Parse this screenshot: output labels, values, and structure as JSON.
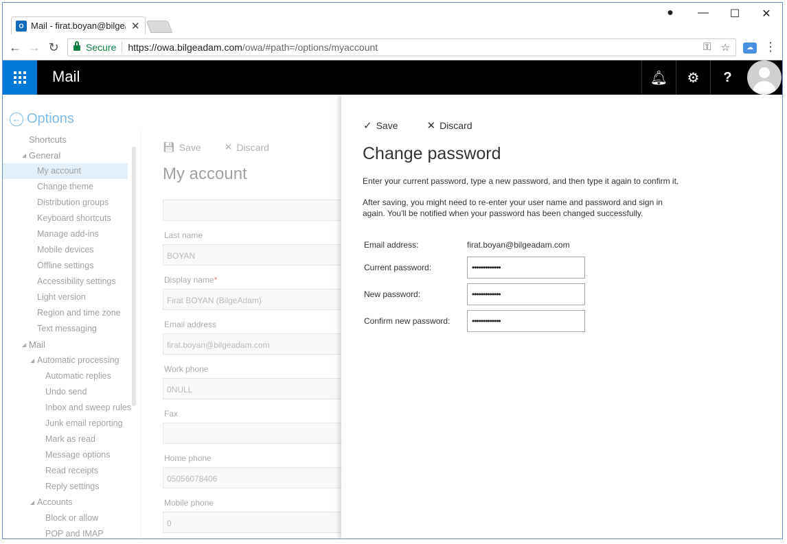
{
  "browser": {
    "tab_title": "Mail - firat.boyan@bilgeadam.com",
    "tab_favicon": "O",
    "secure_label": "Secure",
    "url_host": "https://owa.bilgeadam.com",
    "url_path": "/owa/#path=/options/myaccount"
  },
  "header": {
    "app_title": "Mail"
  },
  "options": {
    "back_label": "Options",
    "nav": [
      {
        "label": "Shortcuts",
        "level": 0,
        "caret": false
      },
      {
        "label": "General",
        "level": 0,
        "caret": true
      },
      {
        "label": "My account",
        "level": 1,
        "selected": true
      },
      {
        "label": "Change theme",
        "level": 1
      },
      {
        "label": "Distribution groups",
        "level": 1
      },
      {
        "label": "Keyboard shortcuts",
        "level": 1
      },
      {
        "label": "Manage add-ins",
        "level": 1
      },
      {
        "label": "Mobile devices",
        "level": 1
      },
      {
        "label": "Offline settings",
        "level": 1
      },
      {
        "label": "Accessibility settings",
        "level": 1
      },
      {
        "label": "Light version",
        "level": 1
      },
      {
        "label": "Region and time zone",
        "level": 1
      },
      {
        "label": "Text messaging",
        "level": 1
      },
      {
        "label": "Mail",
        "level": 0,
        "caret": true
      },
      {
        "label": "Automatic processing",
        "level": 1,
        "caret": true
      },
      {
        "label": "Automatic replies",
        "level": 2
      },
      {
        "label": "Undo send",
        "level": 2
      },
      {
        "label": "Inbox and sweep rules",
        "level": 2
      },
      {
        "label": "Junk email reporting",
        "level": 2
      },
      {
        "label": "Mark as read",
        "level": 2
      },
      {
        "label": "Message options",
        "level": 2
      },
      {
        "label": "Read receipts",
        "level": 2
      },
      {
        "label": "Reply settings",
        "level": 2
      },
      {
        "label": "Accounts",
        "level": 1,
        "caret": true
      },
      {
        "label": "Block or allow",
        "level": 2
      },
      {
        "label": "POP and IMAP",
        "level": 2
      }
    ]
  },
  "my_account": {
    "save_label": "Save",
    "discard_label": "Discard",
    "title": "My account",
    "fields": [
      {
        "label": "Last name",
        "value": "BOYAN",
        "required": false
      },
      {
        "label": "Display name",
        "value": "Firat BOYAN (BilgeAdam)",
        "required": true
      },
      {
        "label": "Email address",
        "value": "firat.boyan@bilgeadam.com",
        "required": false
      },
      {
        "label": "Work phone",
        "value": "0NULL",
        "required": false
      },
      {
        "label": "Fax",
        "value": "",
        "required": false
      },
      {
        "label": "Home phone",
        "value": "05056078406",
        "required": false
      },
      {
        "label": "Mobile phone",
        "value": "0",
        "required": false
      }
    ]
  },
  "change_password": {
    "save_label": "Save",
    "discard_label": "Discard",
    "title": "Change password",
    "desc1": "Enter your current password, type a new password, and then type it again to confirm it.",
    "desc2": "After saving, you might need to re-enter your user name and password and sign in again. You'll be notified when your password has been changed successfully.",
    "email_label": "Email address:",
    "email_value": "firat.boyan@bilgeadam.com",
    "current_label": "Current password:",
    "current_value": "•••••••••••••",
    "new_label": "New password:",
    "new_value": "•••••••••••••",
    "confirm_label": "Confirm new password:",
    "confirm_value": "•••••••••••••"
  },
  "colors": {
    "accent": "#0078d7",
    "header_bg": "#000000",
    "secure_green": "#0b8043"
  }
}
